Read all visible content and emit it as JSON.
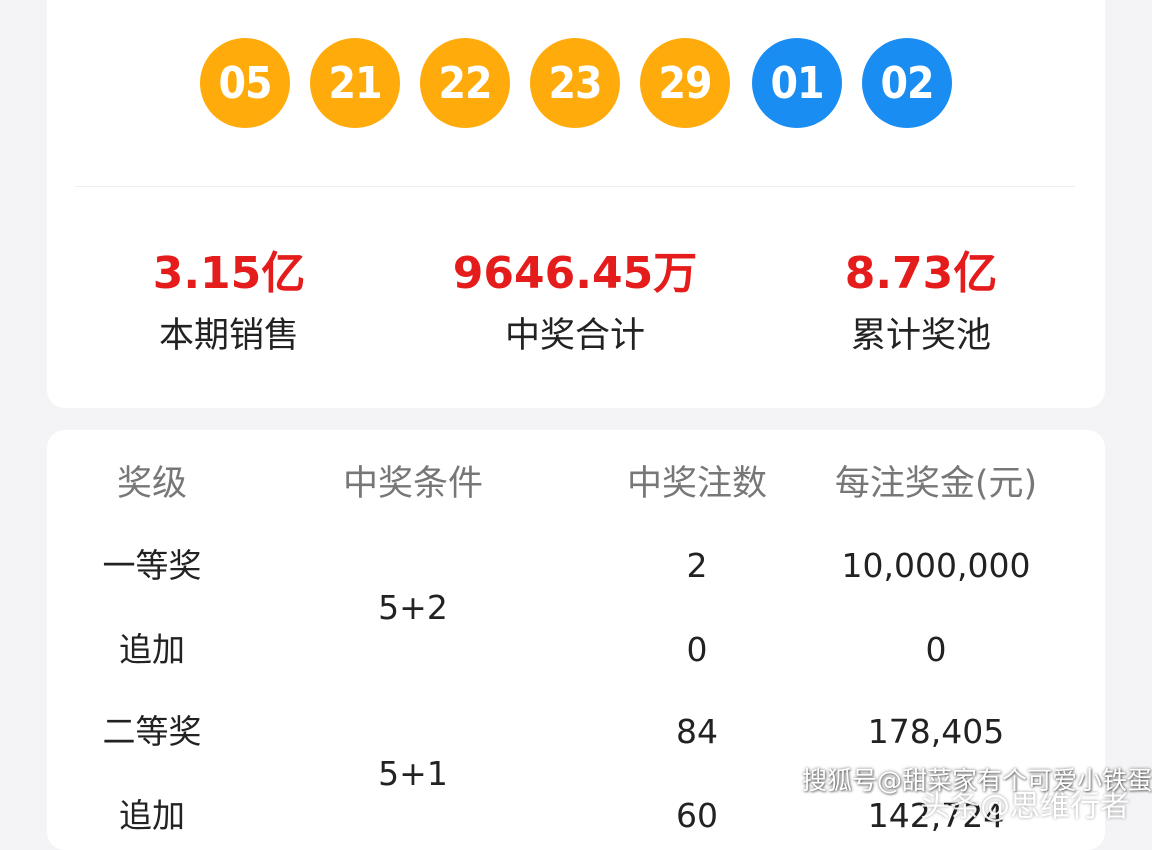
{
  "draw": {
    "front_numbers": [
      "05",
      "21",
      "22",
      "23",
      "29"
    ],
    "back_numbers": [
      "01",
      "02"
    ],
    "colors": {
      "front_ball": "#ffab0b",
      "back_ball": "#1a8df3",
      "highlight": "#e51c1c"
    }
  },
  "stats": [
    {
      "value": "3.15亿",
      "label": "本期销售"
    },
    {
      "value": "9646.45万",
      "label": "中奖合计"
    },
    {
      "value": "8.73亿",
      "label": "累计奖池"
    }
  ],
  "table": {
    "headers": [
      "奖级",
      "中奖条件",
      "中奖注数",
      "每注奖金(元)"
    ],
    "groups": [
      {
        "condition": "5+2",
        "rows": [
          {
            "level": "一等奖",
            "count": "2",
            "prize": "10,000,000"
          },
          {
            "level": "追加",
            "count": "0",
            "prize": "0"
          }
        ]
      },
      {
        "condition": "5+1",
        "rows": [
          {
            "level": "二等奖",
            "count": "84",
            "prize": "178,405"
          },
          {
            "level": "追加",
            "count": "60",
            "prize": "142,724"
          }
        ]
      }
    ]
  },
  "watermark": {
    "text": "搜狐号@甜菜家有个可爱小铁蛋",
    "secondary": "头条@思维行者"
  }
}
